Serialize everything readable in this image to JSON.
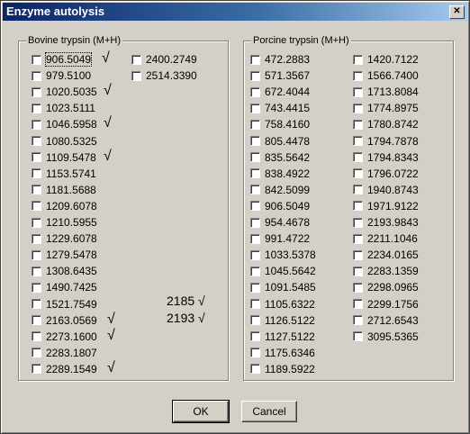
{
  "window": {
    "title": "Enzyme autolysis",
    "close_glyph": "✕"
  },
  "bovine": {
    "legend": "Bovine trypsin  (M+H)",
    "col1": [
      "906.5049",
      "979.5100",
      "1020.5035",
      "1023.5111",
      "1046.5958",
      "1080.5325",
      "1109.5478",
      "1153.5741",
      "1181.5688",
      "1209.6078",
      "1210.5955",
      "1229.6078",
      "1279.5478",
      "1308.6435",
      "1490.7425",
      "1521.7549",
      "2163.0569",
      "2273.1600",
      "2283.1807",
      "2289.1549"
    ],
    "col2": [
      "2400.2749",
      "2514.3390"
    ],
    "checkmark": "√",
    "notes": [
      "2185 √",
      "2193 √"
    ]
  },
  "porcine": {
    "legend": "Porcine trypsin (M+H)",
    "col1": [
      "472.2883",
      "571.3567",
      "672.4044",
      "743.4415",
      "758.4160",
      "805.4478",
      "835.5642",
      "838.4922",
      "842.5099",
      "906.5049",
      "954.4678",
      "991.4722",
      "1033.5378",
      "1045.5642",
      "1091.5485",
      "1105.6322",
      "1126.5122",
      "1127.5122",
      "1175.6346",
      "1189.5922"
    ],
    "col2": [
      "1420.7122",
      "1566.7400",
      "1713.8084",
      "1774.8975",
      "1780.8742",
      "1794.7878",
      "1794.8343",
      "1796.0722",
      "1940.8743",
      "1971.9122",
      "2193.9843",
      "2211.1046",
      "2234.0165",
      "2283.1359",
      "2298.0965",
      "2299.1756",
      "2712.6543",
      "3095.5365"
    ]
  },
  "buttons": {
    "ok": "OK",
    "cancel": "Cancel"
  }
}
